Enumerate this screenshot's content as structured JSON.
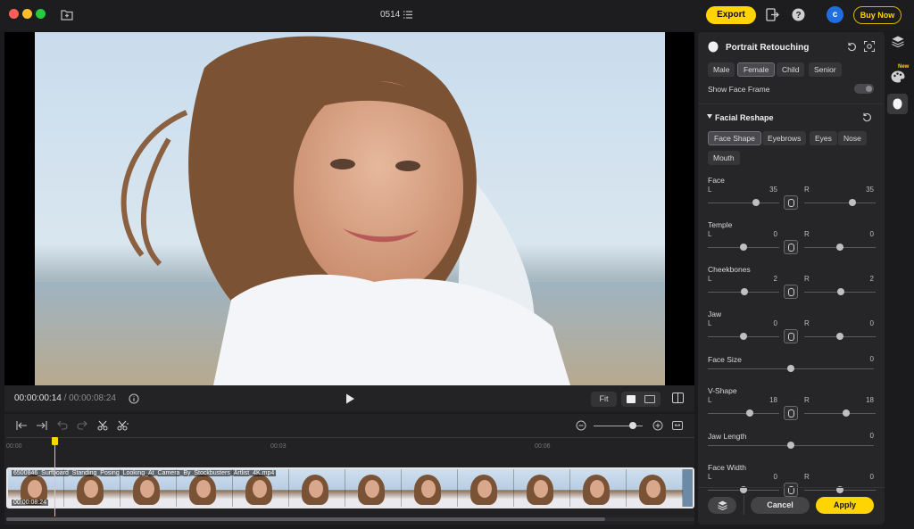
{
  "titlebar": {
    "document_title": "0514",
    "export_label": "Export",
    "buy_label": "Buy Now",
    "avatar_initial": "c"
  },
  "player": {
    "current_time": "00:00:00:14",
    "total_time": "/ 00:00:08:24",
    "fit_label": "Fit"
  },
  "timeline": {
    "ruler": [
      "00:00",
      "00:03",
      "00:06"
    ],
    "clip_name": "6500846_Surfboard_Standing_Posing_Looking_At_Camera_By_Stockbusters_Artlist_4K.mp4",
    "clip_duration": "00:00:08:24",
    "zoom_level": 0.8,
    "scroll_fraction": 0.87
  },
  "panel": {
    "title": "Portrait Retouching",
    "genders": [
      "Male",
      "Female",
      "Child",
      "Senior"
    ],
    "selected_gender": "Female",
    "show_face_frame_label": "Show Face Frame",
    "show_face_frame": false,
    "section_title": "Facial Reshape",
    "tabs": [
      "Face Shape",
      "Eyebrows",
      "Eyes",
      "Nose",
      "Mouth"
    ],
    "selected_tab": "Face Shape",
    "sliders": [
      {
        "label": "Face",
        "paired": true,
        "left_letter": "L",
        "left_value": "35",
        "right_letter": "R",
        "right_value": "35"
      },
      {
        "label": "Temple",
        "paired": true,
        "left_letter": "L",
        "left_value": "0",
        "right_letter": "R",
        "right_value": "0"
      },
      {
        "label": "Cheekbones",
        "paired": true,
        "left_letter": "L",
        "left_value": "2",
        "right_letter": "R",
        "right_value": "2"
      },
      {
        "label": "Jaw",
        "paired": true,
        "left_letter": "L",
        "left_value": "0",
        "right_letter": "R",
        "right_value": "0"
      },
      {
        "label": "Face Size",
        "paired": false,
        "value": "0"
      },
      {
        "label": "V-Shape",
        "paired": true,
        "left_letter": "L",
        "left_value": "18",
        "right_letter": "R",
        "right_value": "18"
      },
      {
        "label": "Jaw Length",
        "paired": false,
        "value": "0"
      },
      {
        "label": "Face Width",
        "paired": true,
        "left_letter": "L",
        "left_value": "0",
        "right_letter": "R",
        "right_value": "0"
      }
    ],
    "cancel_label": "Cancel",
    "apply_label": "Apply"
  },
  "rail": {
    "new_badge": "New"
  },
  "colors": {
    "accent": "#ffd400",
    "avatar": "#1f6fe0",
    "panel_bg": "#262628"
  }
}
